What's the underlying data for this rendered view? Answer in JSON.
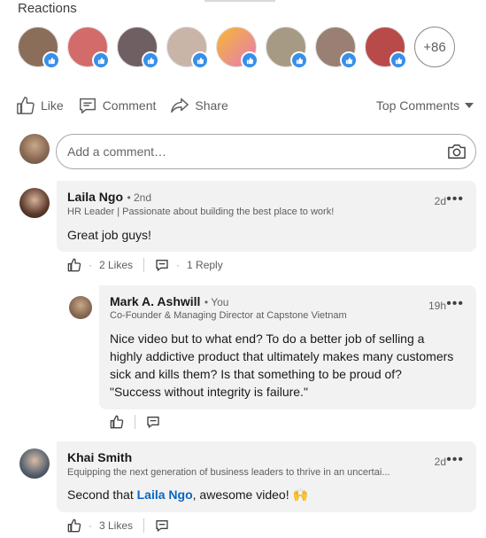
{
  "reactions": {
    "title": "Reactions",
    "more_count": "+86",
    "reactors": [
      {
        "name": "reactor-1",
        "color": "#8a6e5a"
      },
      {
        "name": "reactor-2",
        "color": "#d46b6b"
      },
      {
        "name": "reactor-3",
        "color": "#6f5f62"
      },
      {
        "name": "reactor-4",
        "color": "#c9b4a8"
      },
      {
        "name": "reactor-5",
        "color": "#e37bb6"
      },
      {
        "name": "reactor-6",
        "color": "#a79a84"
      },
      {
        "name": "reactor-7",
        "color": "#9a7f74"
      },
      {
        "name": "reactor-8",
        "color": "#b94a4a"
      }
    ]
  },
  "actions": {
    "like": "Like",
    "comment": "Comment",
    "share": "Share",
    "sort": "Top Comments"
  },
  "composer": {
    "placeholder": "Add a comment…"
  },
  "comments": [
    {
      "name": "Laila Ngo",
      "degree": "• 2nd",
      "headline": "HR Leader | Passionate about building the best place to work!",
      "time": "2d",
      "text": "Great job guys!",
      "likes": "2 Likes",
      "replies": "1 Reply"
    },
    {
      "name": "Mark A. Ashwill",
      "degree": "• You",
      "headline": "Co-Founder & Managing Director at Capstone Vietnam",
      "time": "19h",
      "text": "Nice video but to what end?  To do a better job of selling a highly addictive product that ultimately makes many customers sick and kills them?  Is that something to be proud of?  \"Success without integrity is failure.\""
    },
    {
      "name": "Khai Smith",
      "headline": "Equipping the next generation of business leaders to thrive in an uncertai...",
      "time": "2d",
      "text_before": "Second that ",
      "mention": "Laila Ngo",
      "text_after": ", awesome video! 🙌",
      "likes": "3 Likes"
    }
  ]
}
